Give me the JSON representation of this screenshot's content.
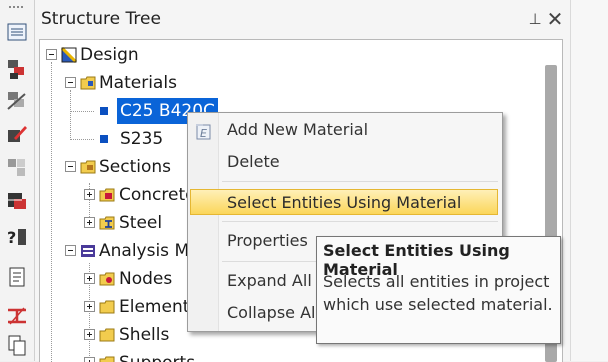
{
  "panel": {
    "title": "Structure Tree",
    "pin_glyph": "⊥",
    "close_glyph": "✕"
  },
  "toolbar": {
    "buttons": [
      "list-icon",
      "model-icon",
      "edit-model-icon",
      "disabled-model-icon",
      "grid-icon",
      "analysis-icon",
      "help-icon",
      "report-icon",
      "section-icon",
      "copy-icon"
    ],
    "help_text": "?"
  },
  "tree": {
    "root": "Design",
    "materials": "Materials",
    "material_items": [
      "C25 B420C",
      "S235"
    ],
    "sections": "Sections",
    "section_items": [
      "Concrete",
      "Steel"
    ],
    "analysis_model": "Analysis Model",
    "analysis_items": [
      "Nodes",
      "Elements",
      "Shells",
      "Supports"
    ]
  },
  "context_menu": {
    "items": {
      "add": "Add New Material",
      "delete": "Delete",
      "select": "Select Entities Using Material",
      "properties": "Properties",
      "expand": "Expand All",
      "collapse": "Collapse All"
    },
    "highlight_color": "#fbd65a"
  },
  "tooltip": {
    "title": "Select Entities Using Material",
    "body": "Selects all entities in project which use selected material."
  },
  "colors": {
    "selection": "#0a64d8",
    "accent": "#0b50c0"
  }
}
